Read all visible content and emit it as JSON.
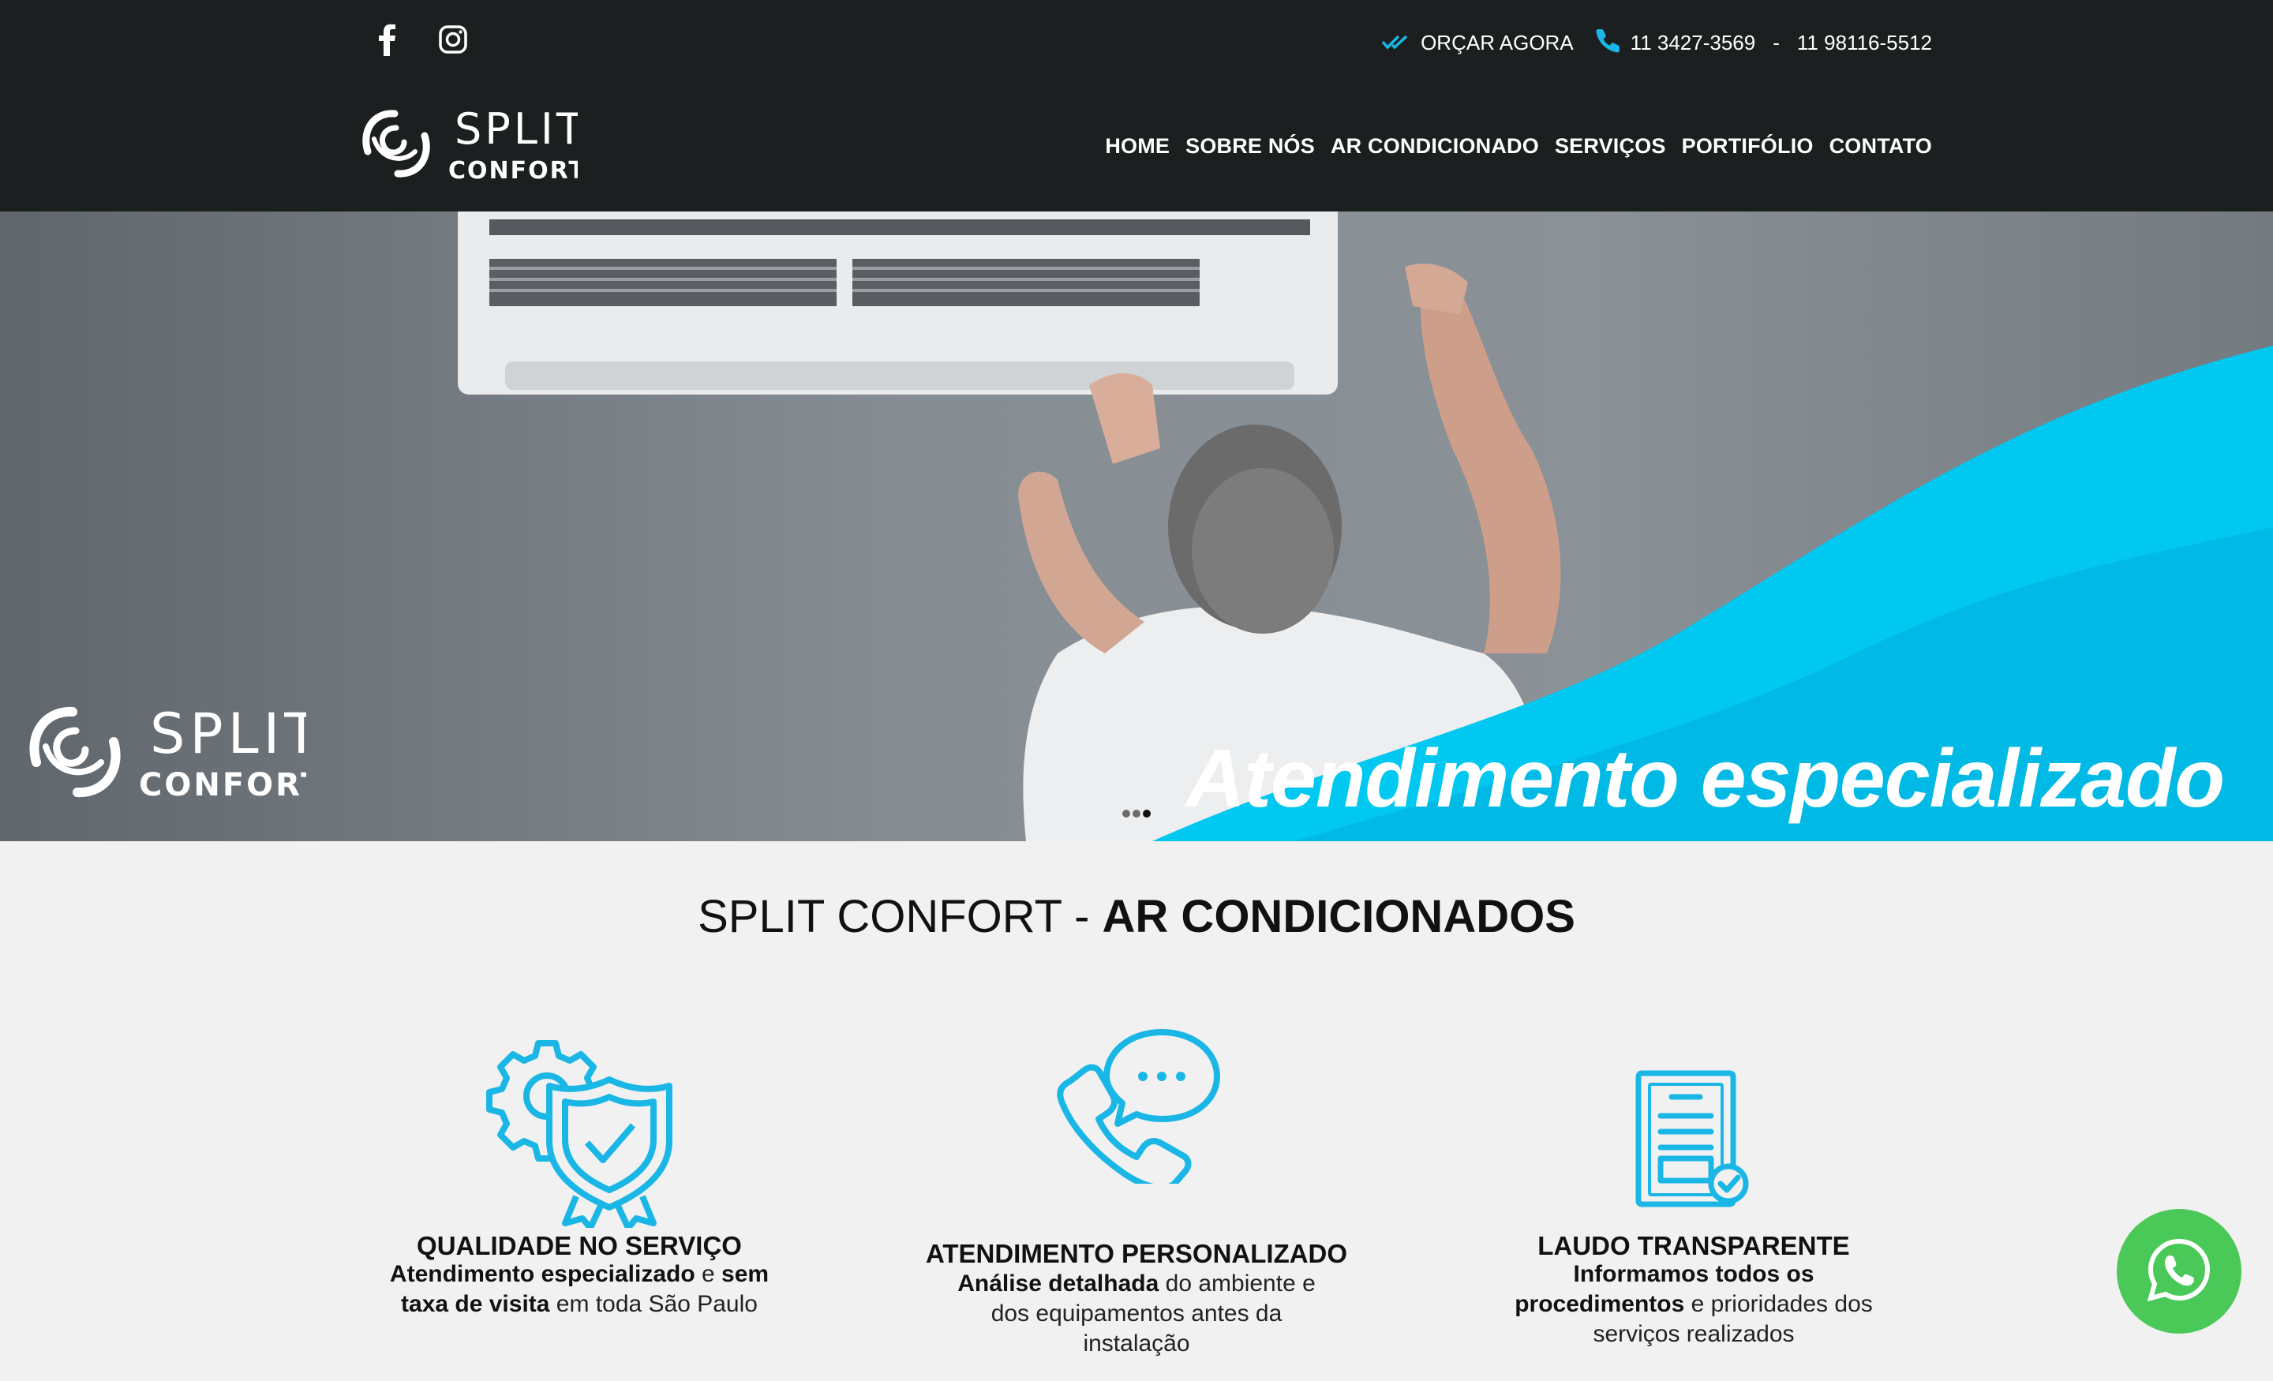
{
  "header": {
    "social": [
      {
        "name": "facebook",
        "icon": "facebook-icon"
      },
      {
        "name": "instagram",
        "icon": "instagram-icon"
      }
    ],
    "quote_label": "ORÇAR AGORA",
    "phone_1": "11 3427-3569",
    "phone_separator": "-",
    "phone_2": "11 98116-5512",
    "logo": {
      "line1": "SPLIT",
      "line2": "CONFORT"
    },
    "nav": [
      "HOME",
      "SOBRE NÓS",
      "AR CONDICIONADO",
      "SERVIÇOS",
      "PORTIFÓLIO",
      "CONTATO"
    ]
  },
  "hero": {
    "logo": {
      "line1": "SPLIT",
      "line2": "CONFORT"
    },
    "tagline": "Atendimento especializado",
    "slides": 3,
    "active_slide": 3,
    "accent_color": "#00c8f0"
  },
  "section": {
    "title_light": "SPLIT CONFORT - ",
    "title_bold": "AR CONDICIONADOS"
  },
  "features": [
    {
      "icon": "gear-shield-check-icon",
      "title": "QUALIDADE NO SERVIÇO",
      "b1": "Atendimento especializado",
      "t1": " e ",
      "b2": "sem taxa de visita",
      "t2": " em toda São Paulo"
    },
    {
      "icon": "phone-chat-icon",
      "title": "ATENDIMENTO PERSONALIZADO",
      "b1": "Análise detalhada",
      "t1": " do ambiente e dos equipamentos antes da instalação"
    },
    {
      "icon": "report-check-icon",
      "title": "LAUDO TRANSPARENTE",
      "b1": "Informamos todos os procedimentos",
      "t1": " e prioridades dos serviços realizados"
    }
  ],
  "colors": {
    "header_bg": "#1b1f20",
    "icon_blue": "#1ab7e6",
    "whatsapp": "#4ac959"
  },
  "whatsapp": {
    "icon": "whatsapp-icon"
  }
}
